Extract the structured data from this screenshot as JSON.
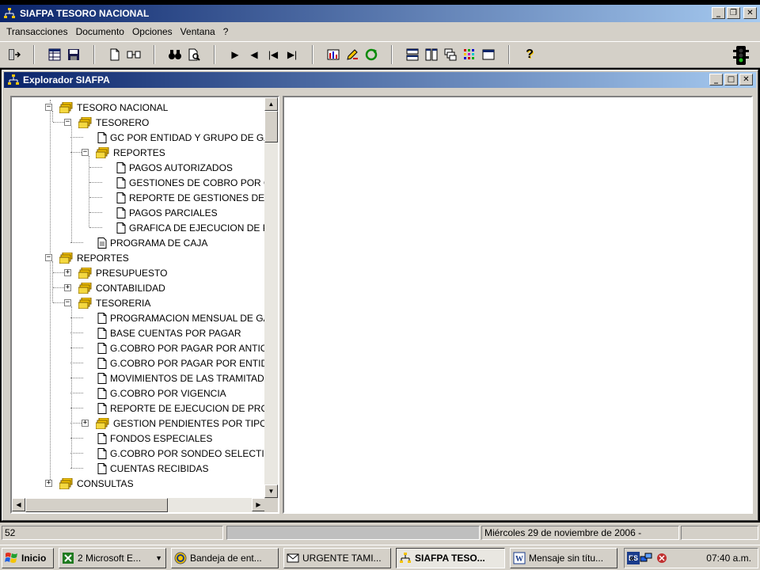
{
  "window": {
    "title": "SIAFPA TESORO NACIONAL"
  },
  "menu": [
    "Transacciones",
    "Documento",
    "Opciones",
    "Ventana",
    "?"
  ],
  "explorer": {
    "title": "Explorador SIAFPA"
  },
  "tree": [
    {
      "label": "TESORO NACIONAL",
      "type": "folder",
      "level": 1,
      "expander": "−"
    },
    {
      "label": "TESORERO",
      "type": "folder",
      "level": 2,
      "expander": "−"
    },
    {
      "label": "GC POR ENTIDAD Y GRUPO DE GA",
      "type": "doc",
      "level": 3
    },
    {
      "label": "REPORTES",
      "type": "folder",
      "level": 3,
      "expander": "−"
    },
    {
      "label": "PAGOS AUTORIZADOS",
      "type": "doc",
      "level": 4
    },
    {
      "label": "GESTIONES DE COBRO POR G",
      "type": "doc",
      "level": 4
    },
    {
      "label": "REPORTE DE GESTIONES DE C",
      "type": "doc",
      "level": 4
    },
    {
      "label": "PAGOS PARCIALES",
      "type": "doc",
      "level": 4
    },
    {
      "label": "GRAFICA DE EJECUCION DE PI",
      "type": "doc",
      "level": 4
    },
    {
      "label": "PROGRAMA DE CAJA",
      "type": "report",
      "level": 3
    },
    {
      "label": "REPORTES",
      "type": "folder",
      "level": 1,
      "expander": "−"
    },
    {
      "label": "PRESUPUESTO",
      "type": "folder",
      "level": 2,
      "expander": "+"
    },
    {
      "label": "CONTABILIDAD",
      "type": "folder",
      "level": 2,
      "expander": "+"
    },
    {
      "label": "TESORERIA",
      "type": "folder",
      "level": 2,
      "expander": "−"
    },
    {
      "label": "PROGRAMACION MENSUAL DE GA",
      "type": "doc",
      "level": 3
    },
    {
      "label": "BASE CUENTAS POR PAGAR",
      "type": "doc",
      "level": 3
    },
    {
      "label": "G.COBRO POR PAGAR POR ANTIC",
      "type": "doc",
      "level": 3
    },
    {
      "label": "G.COBRO POR PAGAR POR ENTID",
      "type": "doc",
      "level": 3
    },
    {
      "label": "MOVIMIENTOS DE LAS TRAMITADA",
      "type": "doc",
      "level": 3
    },
    {
      "label": "G.COBRO POR VIGENCIA",
      "type": "doc",
      "level": 3
    },
    {
      "label": "REPORTE DE EJECUCION DE PROG",
      "type": "doc",
      "level": 3
    },
    {
      "label": "GESTION PENDIENTES POR TIPO D",
      "type": "folder",
      "level": 3,
      "expander": "+"
    },
    {
      "label": "FONDOS ESPECIALES",
      "type": "doc",
      "level": 3
    },
    {
      "label": "G.COBRO POR SONDEO SELECTIV",
      "type": "doc",
      "level": 3
    },
    {
      "label": "CUENTAS RECIBIDAS",
      "type": "doc",
      "level": 3
    },
    {
      "label": "CONSULTAS",
      "type": "folder",
      "level": 1,
      "expander": "+"
    }
  ],
  "status": {
    "left": "52",
    "middle": "",
    "date": "Miércoles 29 de noviembre de 2006 -"
  },
  "taskbar": {
    "start": "Inicio",
    "tasks": [
      {
        "label": "2 Microsoft E...",
        "icon": "excel-icon"
      },
      {
        "label": "Bandeja de ent...",
        "icon": "outlook-icon"
      },
      {
        "label": "URGENTE TAMI...",
        "icon": "envelope-icon"
      },
      {
        "label": "SIAFPA TESO...",
        "icon": "siafpa-icon",
        "active": true
      },
      {
        "label": "Mensaje sin títu...",
        "icon": "word-icon"
      }
    ],
    "lang": "ES",
    "clock": "07:40 a.m."
  },
  "colors": {
    "titlebar_start": "#0a246a",
    "titlebar_end": "#a6caf0",
    "face": "#d4d0c8"
  }
}
